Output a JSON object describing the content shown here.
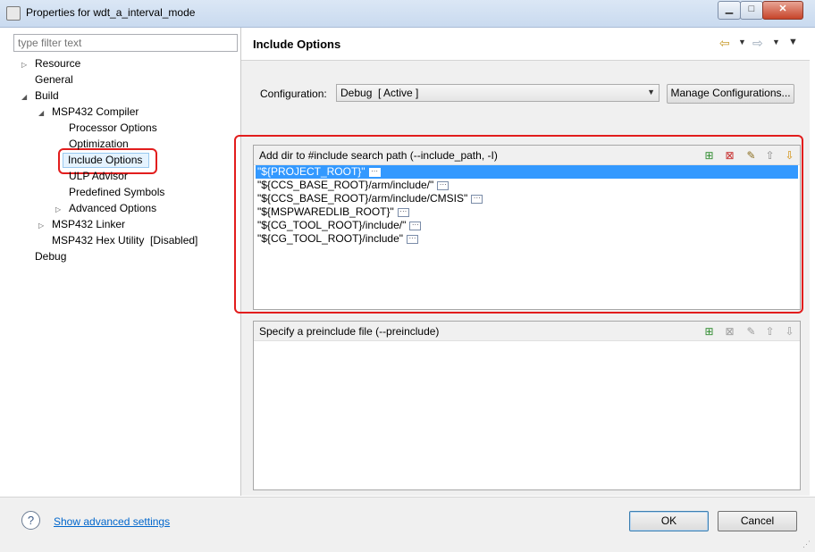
{
  "window": {
    "title": "Properties for wdt_a_interval_mode",
    "buttons": {
      "minimize": "▁",
      "maximize": "□",
      "close": "✕"
    }
  },
  "sidebar": {
    "filter_placeholder": "type filter text",
    "tree": [
      {
        "label": "Resource",
        "twisty": "▷"
      },
      {
        "label": "General",
        "twisty": ""
      },
      {
        "label": "Build",
        "twisty": "◢"
      },
      {
        "label": "MSP432 Compiler",
        "twisty": "◢"
      },
      {
        "label": "Processor Options",
        "twisty": ""
      },
      {
        "label": "Optimization",
        "twisty": ""
      },
      {
        "label": "Include Options",
        "twisty": "",
        "selected": true
      },
      {
        "label": "ULP Advisor",
        "twisty": ""
      },
      {
        "label": "Predefined Symbols",
        "twisty": ""
      },
      {
        "label": "Advanced Options",
        "twisty": "▷"
      },
      {
        "label": "MSP432 Linker",
        "twisty": "▷"
      },
      {
        "label": "MSP432 Hex Utility  [Disabled]",
        "twisty": ""
      },
      {
        "label": "Debug",
        "twisty": ""
      }
    ]
  },
  "header": {
    "title": "Include Options",
    "nav_icons": [
      "back-arrow-icon",
      "dropdown-icon",
      "forward-arrow-icon",
      "dropdown-icon",
      "view-menu-icon"
    ]
  },
  "configuration": {
    "label": "Configuration:",
    "selected": "Debug  [ Active ]",
    "manage_button": "Manage Configurations..."
  },
  "include_panel": {
    "title": "Add dir to #include search path (--include_path, -I)",
    "tools": [
      "add-icon",
      "delete-icon",
      "edit-icon",
      "move-up-icon",
      "move-down-icon"
    ],
    "paths": [
      "\"${PROJECT_ROOT}\"",
      "\"${CCS_BASE_ROOT}/arm/include/\"",
      "\"${CCS_BASE_ROOT}/arm/include/CMSIS\"",
      "\"${MSPWAREDLIB_ROOT}\"",
      "\"${CG_TOOL_ROOT}/include/\"",
      "\"${CG_TOOL_ROOT}/include\""
    ],
    "more_glyph": "···"
  },
  "preinclude_panel": {
    "title": "Specify a preinclude file (--preinclude)",
    "tools": [
      "add-icon",
      "delete-icon",
      "edit-icon",
      "move-up-icon",
      "move-down-icon"
    ]
  },
  "footer": {
    "help_glyph": "?",
    "advanced_link": "Show advanced settings",
    "ok": "OK",
    "cancel": "Cancel"
  },
  "colors": {
    "highlight_red": "#e21d1d",
    "selection_blue": "#3399ff",
    "link_blue": "#0066cc"
  }
}
